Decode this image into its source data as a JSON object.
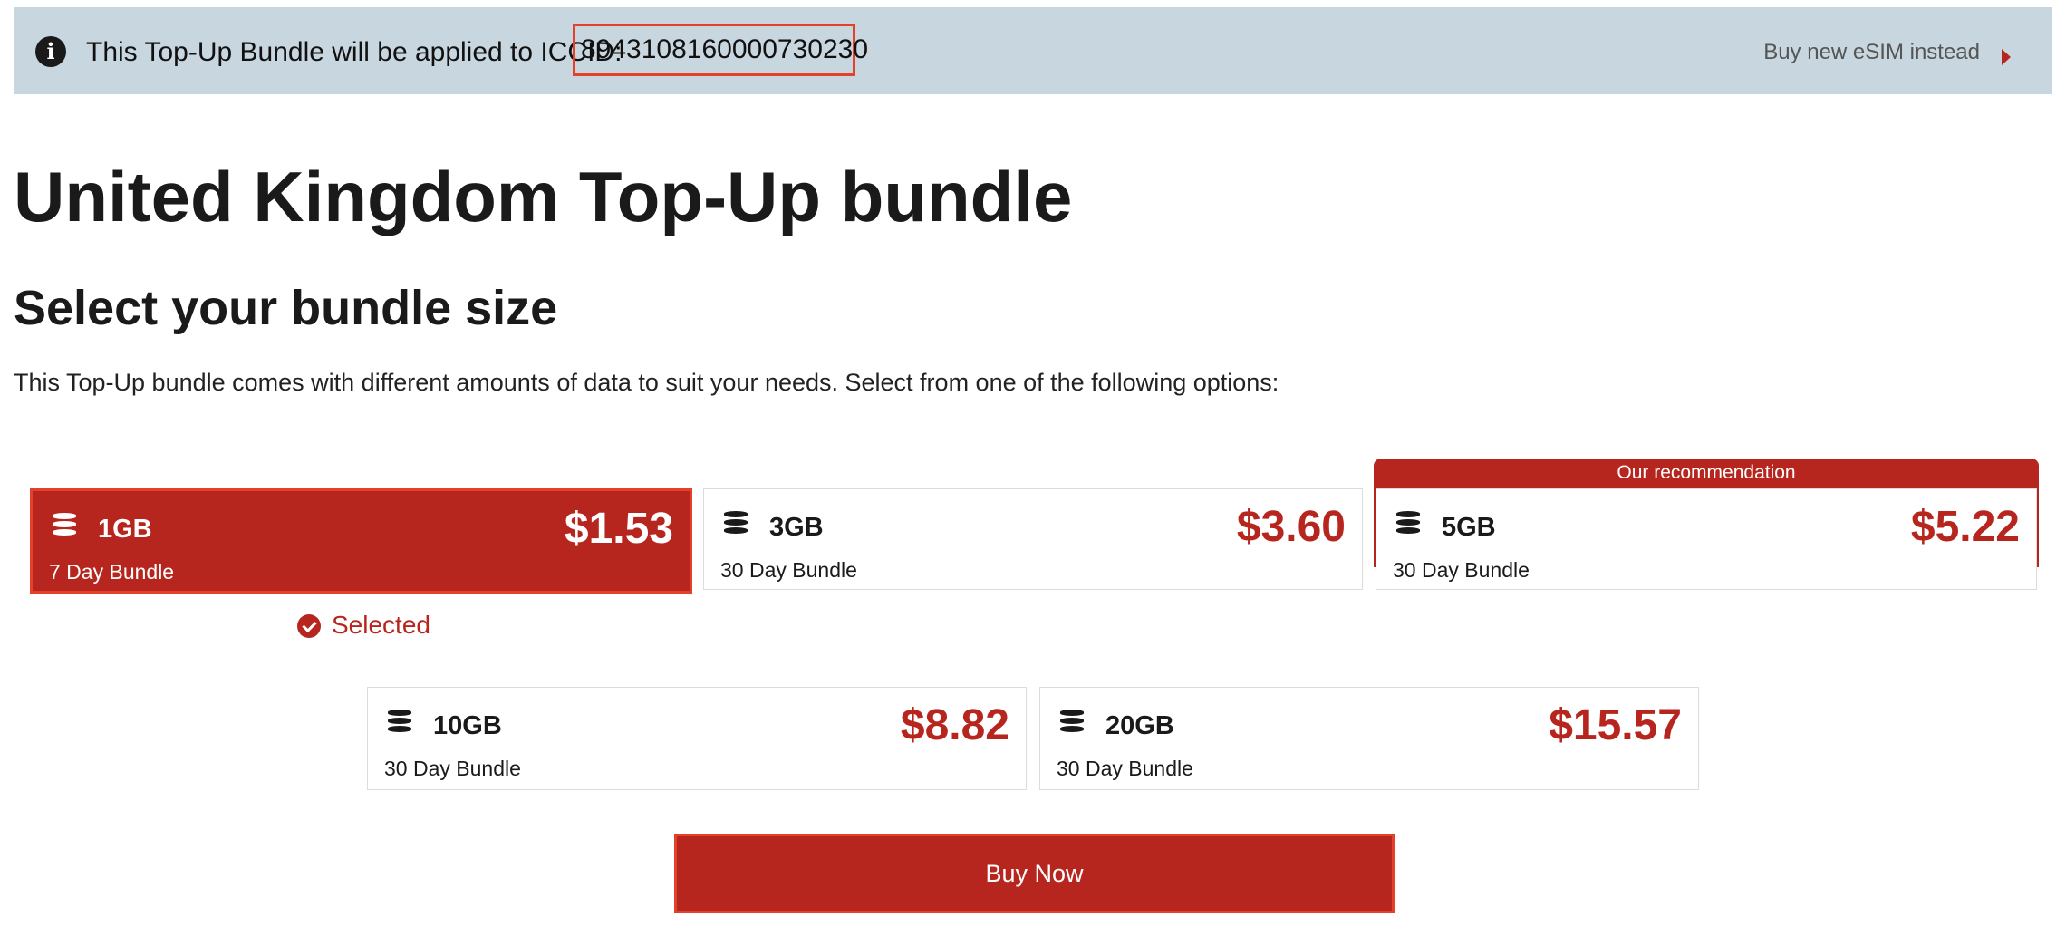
{
  "banner": {
    "text": "This Top-Up Bundle will be applied to ICCID:",
    "iccid": "8943108160000730230",
    "alt_link": "Buy new eSIM instead"
  },
  "heading": "United Kingdom Top-Up bundle",
  "subheading": "Select your bundle size",
  "lead": "This Top-Up bundle comes with different amounts of data to suit your needs. Select from one of the following options:",
  "bundles": [
    {
      "size": "1GB",
      "duration": "7 Day Bundle",
      "price": "$1.53",
      "selected": true
    },
    {
      "size": "3GB",
      "duration": "30 Day Bundle",
      "price": "$3.60"
    },
    {
      "size": "5GB",
      "duration": "30 Day Bundle",
      "price": "$5.22",
      "badge": "Our recommendation"
    },
    {
      "size": "10GB",
      "duration": "30 Day Bundle",
      "price": "$8.82"
    },
    {
      "size": "20GB",
      "duration": "30 Day Bundle",
      "price": "$15.57"
    }
  ],
  "selected_label": "Selected",
  "buy_button": "Buy Now",
  "colors": {
    "accent": "#b7261e",
    "banner_bg": "#c8d6df",
    "highlight_border": "#e4402a"
  }
}
